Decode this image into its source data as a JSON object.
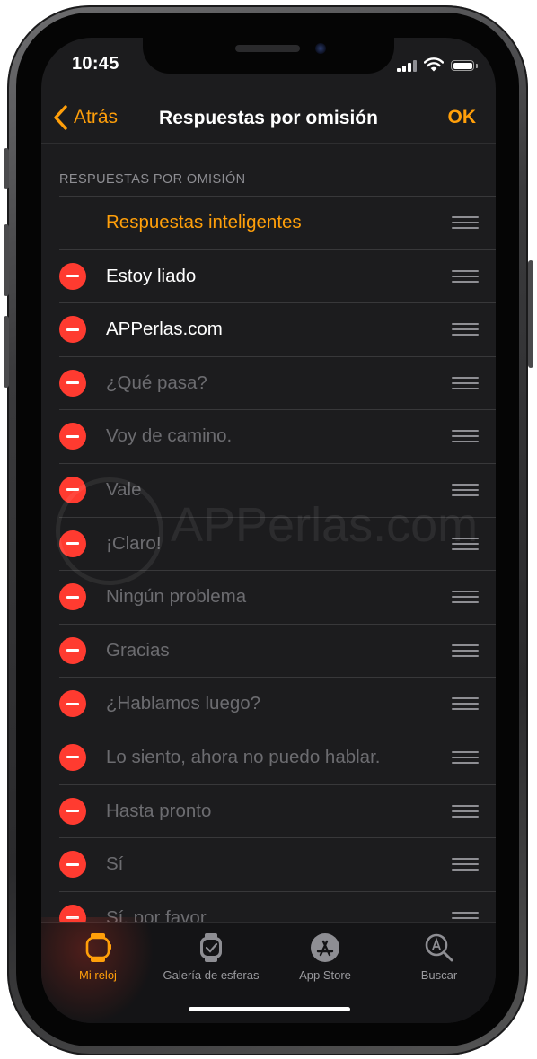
{
  "status_bar": {
    "time": "10:45"
  },
  "navbar": {
    "back_label": "Atrás",
    "title": "Respuestas por omisión",
    "ok_label": "OK"
  },
  "section": {
    "header": "RESPUESTAS POR OMISIÓN"
  },
  "list": {
    "smart_replies_label": "Respuestas inteligentes",
    "items": [
      {
        "label": "Estoy liado"
      },
      {
        "label": "APPerlas.com"
      },
      {
        "label": "¿Qué pasa?"
      },
      {
        "label": "Voy de camino."
      },
      {
        "label": "Vale"
      },
      {
        "label": "¡Claro!"
      },
      {
        "label": "Ningún problema"
      },
      {
        "label": "Gracias"
      },
      {
        "label": "¿Hablamos luego?"
      },
      {
        "label": "Lo siento, ahora no puedo hablar."
      },
      {
        "label": "Hasta pronto"
      },
      {
        "label": "Sí"
      },
      {
        "label": "Sí, por favor"
      }
    ]
  },
  "watermark": {
    "text": "APPerlas.com"
  },
  "tabbar": {
    "tabs": [
      {
        "label": "Mi reloj",
        "icon": "watch-icon",
        "active": true
      },
      {
        "label": "Galería de esferas",
        "icon": "watch-face-gallery-icon",
        "active": false
      },
      {
        "label": "App Store",
        "icon": "app-store-icon",
        "active": false
      },
      {
        "label": "Buscar",
        "icon": "search-icon",
        "active": false
      }
    ]
  },
  "colors": {
    "accent": "#ff9f0a",
    "delete": "#ff3b30",
    "background": "#1c1c1e",
    "text_dim": "#6c6c70"
  }
}
